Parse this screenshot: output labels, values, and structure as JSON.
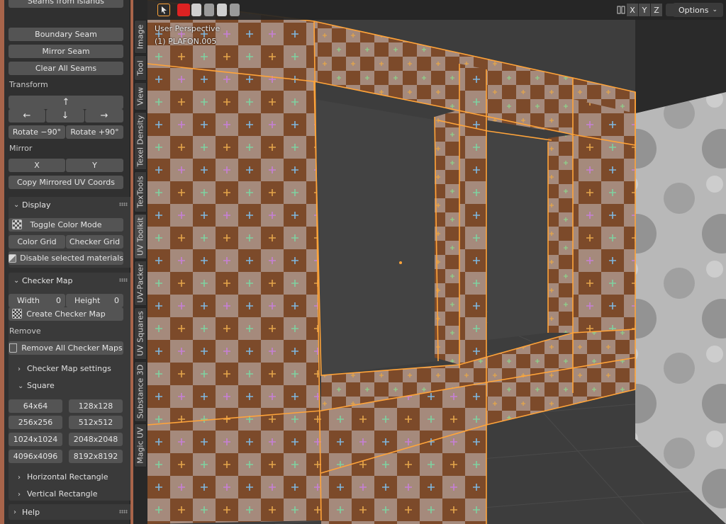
{
  "panel": {
    "partial_top": "Seams from Islands",
    "boundary_seam": "Boundary Seam",
    "mirror_seam": "Mirror Seam",
    "clear_all_seams": "Clear All Seams",
    "transform_label": "Transform",
    "arrow_up": "↑",
    "arrow_left": "←",
    "arrow_down": "↓",
    "arrow_right": "→",
    "rotate_neg": "Rotate −90°",
    "rotate_pos": "Rotate +90°",
    "mirror_label": "Mirror",
    "mirror_x": "X",
    "mirror_y": "Y",
    "copy_mirrored": "Copy Mirrored UV Coords",
    "display_header": "Display",
    "toggle_color_mode": "Toggle Color Mode",
    "color_grid": "Color Grid",
    "checker_grid": "Checker Grid",
    "disable_selected": "Disable selected materials",
    "checker_header": "Checker Map",
    "width_label": "Width",
    "width_value": "0",
    "height_label": "Height",
    "height_value": "0",
    "create_checker": "Create Checker Map",
    "remove_label": "Remove",
    "remove_all": "Remove All Checker Maps",
    "checker_settings": "Checker Map settings",
    "square": "Square",
    "sizes": [
      "64x64",
      "128x128",
      "256x256",
      "512x512",
      "1024x1024",
      "2048x2048",
      "4096x4096",
      "8192x8192"
    ],
    "horizontal_rect": "Horizontal Rectangle",
    "vertical_rect": "Vertical Rectangle",
    "help_header": "Help"
  },
  "tabs": [
    "Image",
    "Tool",
    "View",
    "Texel Density",
    "TexTools",
    "UV Toolkit",
    "UV-Packer",
    "UV Squares",
    "Substance 3D",
    "Magic UV"
  ],
  "viewport": {
    "perspective": "User Perspective",
    "object": "(1) PLAFON.005",
    "axis_x": "X",
    "axis_y": "Y",
    "axis_z": "Z",
    "options": "Options"
  },
  "colors": {
    "panel_bg": "#303030",
    "button_bg": "#545454",
    "selection_outline": "#ffa43a",
    "checker_dark": "#7c4a2a",
    "checker_light": "#a58a7c"
  }
}
